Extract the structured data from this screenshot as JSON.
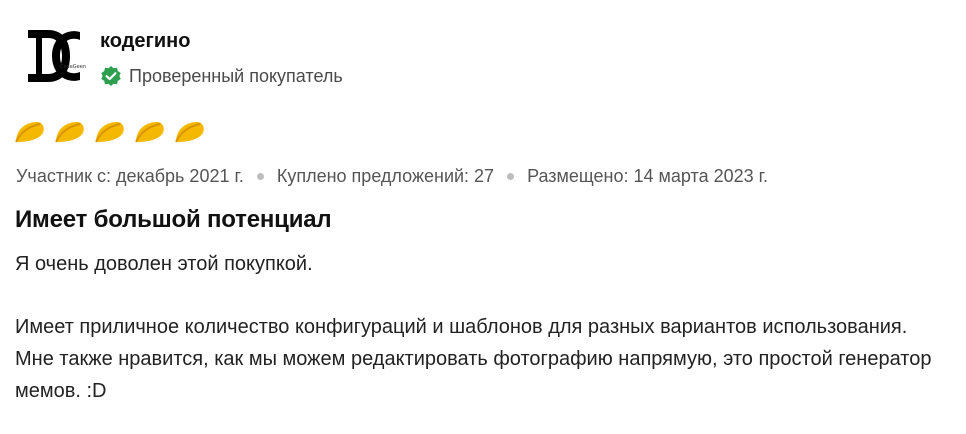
{
  "review": {
    "reviewer": {
      "name": "кодегино",
      "avatar_icon": "codegeenee-logo-icon",
      "badge_text": "Проверенный покупатель",
      "badge_icon": "verified-check-icon",
      "badge_color": "#2e9e4f"
    },
    "rating": {
      "value": 5,
      "max": 5,
      "icon": "taco-icon",
      "color": "#f5b800"
    },
    "meta": {
      "member_since": "Участник с: декабрь 2021 г.",
      "deals_bought": "Куплено предложений: 27",
      "posted": "Размещено: 14 марта 2023 г."
    },
    "title": "Имеет большой потенциал",
    "paragraphs": [
      "Я очень доволен этой покупкой.",
      "Имеет приличное количество конфигураций и шаблонов для разных вариантов использования. Мне также нравится, как мы можем редактировать фотографию напрямую, это простой генератор мемов. :D"
    ]
  }
}
